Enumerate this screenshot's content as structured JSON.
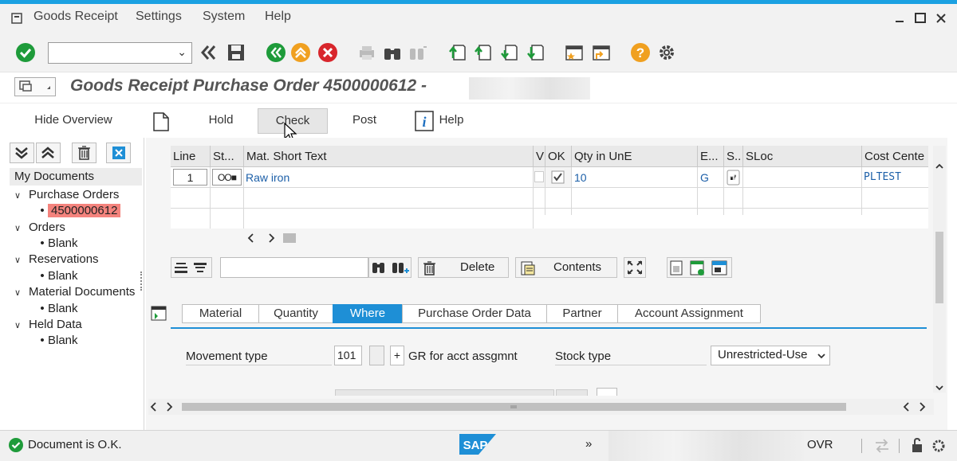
{
  "menu": {
    "items": [
      {
        "label": "Goods Receipt"
      },
      {
        "label": "Settings"
      },
      {
        "label": "System"
      },
      {
        "label": "Help"
      }
    ]
  },
  "title": {
    "text": "Goods Receipt Purchase Order 4500000612 -"
  },
  "app_toolbar": {
    "hide_overview": "Hide Overview",
    "hold": "Hold",
    "check": "Check",
    "post": "Post",
    "help": "Help"
  },
  "left_panel": {
    "root": "My Documents",
    "nodes": [
      {
        "label": "Purchase Orders",
        "child": "4500000612"
      },
      {
        "label": "Orders",
        "child": "Blank"
      },
      {
        "label": "Reservations",
        "child": "Blank"
      },
      {
        "label": "Material Documents",
        "child": "Blank"
      },
      {
        "label": "Held Data",
        "child": "Blank"
      }
    ]
  },
  "grid": {
    "columns": [
      "Line",
      "St...",
      "Mat. Short Text",
      "V",
      "OK",
      "Qty in UnE",
      "E...",
      "S..",
      "SLoc",
      "Cost Cente"
    ],
    "rows": [
      {
        "line": "1",
        "status": "OO■",
        "text": "Raw iron",
        "qty": "10",
        "e": "G",
        "cost": "PLTEST"
      }
    ]
  },
  "item_toolbar": {
    "delete": "Delete",
    "contents": "Contents"
  },
  "tabs": [
    {
      "label": "Material"
    },
    {
      "label": "Quantity"
    },
    {
      "label": "Where"
    },
    {
      "label": "Purchase Order Data"
    },
    {
      "label": "Partner"
    },
    {
      "label": "Account Assignment"
    }
  ],
  "where_tab": {
    "movement_type_label": "Movement type",
    "movement_type_value": "101",
    "plus": "+",
    "gr_text": "GR for acct assgmnt",
    "stock_type_label": "Stock type",
    "stock_type_value": "Unrestricted-Use"
  },
  "status": {
    "message": "Document is O.K.",
    "mode": "OVR",
    "logo": "SAP"
  },
  "colors": {
    "accent": "#1e8fd6",
    "selection": "#f4837d",
    "ok_green": "#1e9b3a"
  }
}
